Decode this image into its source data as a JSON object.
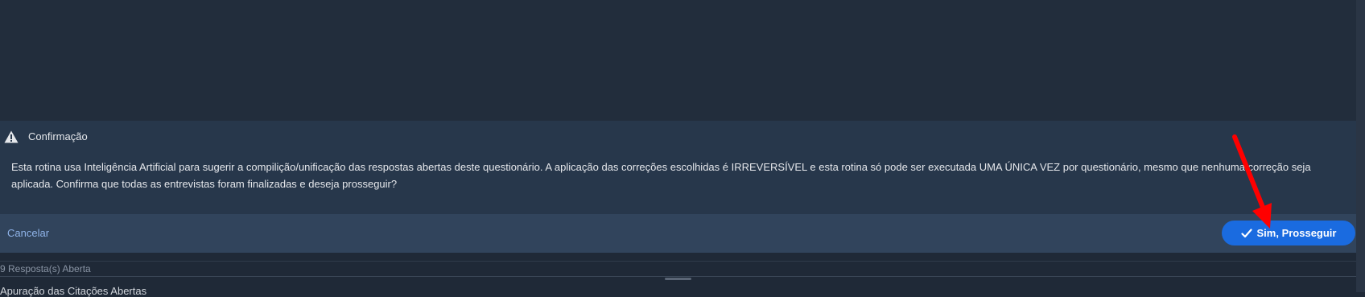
{
  "dialog": {
    "title": "Confirmação",
    "icon": "warning-icon",
    "message": "Esta rotina usa Inteligência Artificial para sugerir a compilição/unificação das respostas abertas deste questionário. A aplicação das correções escolhidas é IRREVERSÍVEL e esta rotina só pode ser executada UMA ÚNICA VEZ por questionário, mesmo que nenhuma correção seja aplicada. Confirma que todas as entrevistas foram finalizadas e deseja prosseguir?",
    "cancel_label": "Cancelar",
    "confirm_label": "Sim, Prosseguir",
    "confirm_icon": "check-icon"
  },
  "status": {
    "text": "9 Resposta(s) Aberta"
  },
  "section": {
    "label": "Apuração das Citações Abertas"
  },
  "colors": {
    "background": "#1f2937",
    "dialog": "#27374b",
    "footer": "#31445c",
    "primary": "#1a6be0",
    "link": "#8fb3e8",
    "annotation_arrow": "#ff0000"
  }
}
